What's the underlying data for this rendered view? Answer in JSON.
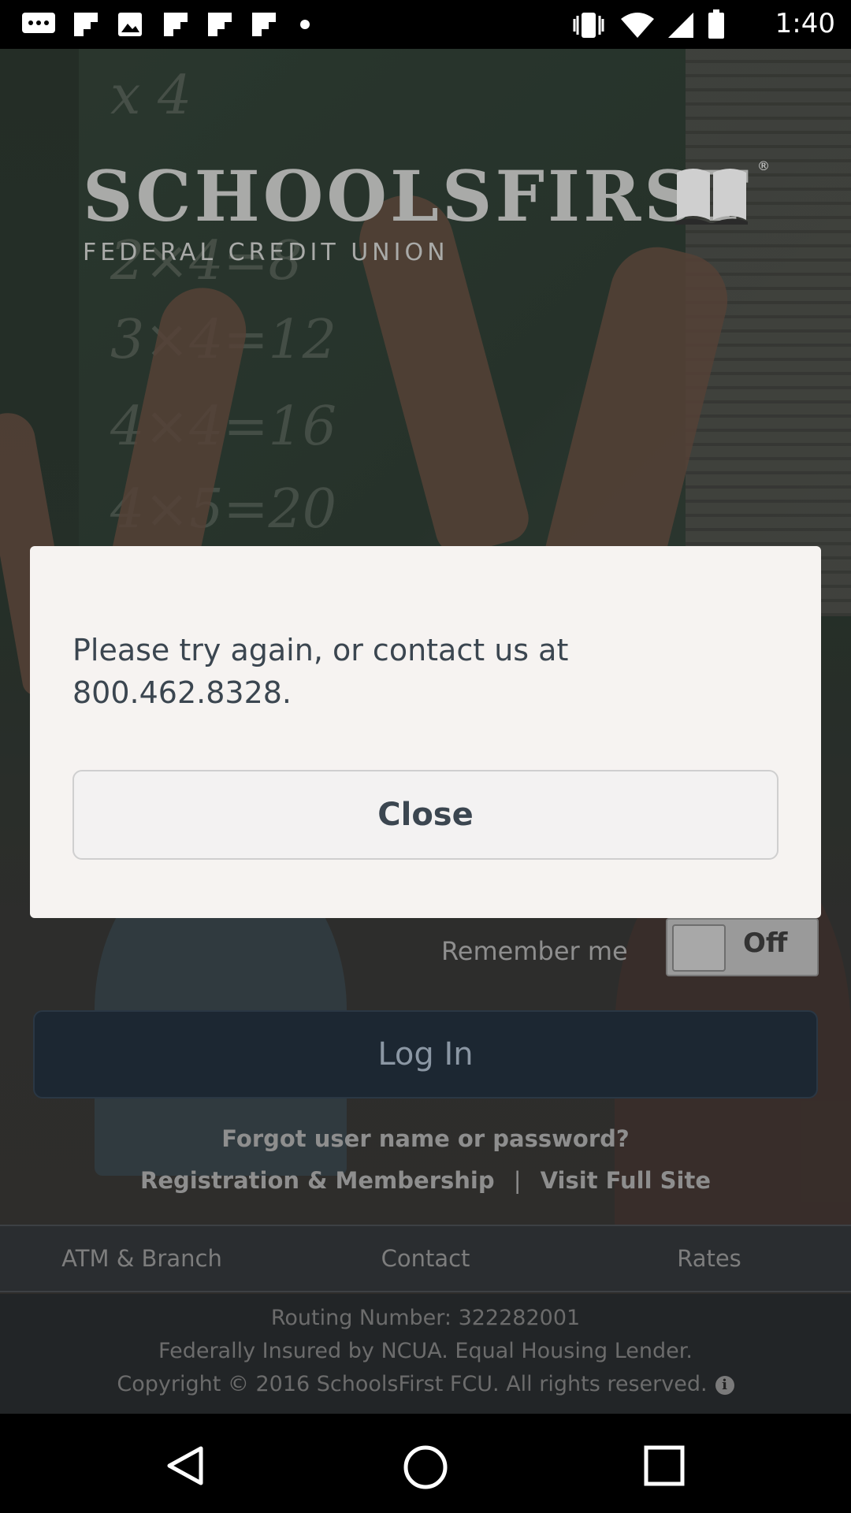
{
  "status_bar": {
    "time": "1:40",
    "icons": [
      "message-icon",
      "flipboard-icon",
      "photo-icon",
      "flipboard-icon",
      "flipboard-icon",
      "flipboard-icon",
      "dot-icon",
      "vibrate-icon",
      "wifi-icon",
      "signal-icon",
      "battery-icon"
    ]
  },
  "brand": {
    "title": "SCHOOLSFIRST",
    "registered": "®",
    "subtitle": "FEDERAL CREDIT UNION"
  },
  "chalk_lines": [
    "x 4",
    "2×4=8",
    "3×4=12",
    "4×4=16",
    "4×5=20"
  ],
  "modal": {
    "message": "Please try again, or contact us at 800.462.8328.",
    "close_label": "Close"
  },
  "login": {
    "remember_label": "Remember me",
    "remember_state": "Off",
    "login_label": "Log In",
    "forgot_label": "Forgot user name or password?",
    "registration_label": "Registration & Membership",
    "separator": "|",
    "full_site_label": "Visit Full Site"
  },
  "bottom_nav": {
    "items": [
      {
        "label": "ATM & Branch"
      },
      {
        "label": "Contact"
      },
      {
        "label": "Rates"
      }
    ]
  },
  "footer": {
    "routing": "Routing Number: 322282001",
    "insured": "Federally Insured by NCUA. Equal Housing Lender.",
    "copyright": "Copyright © 2016 SchoolsFirst FCU. All rights reserved.",
    "info_glyph": "i"
  },
  "colors": {
    "login_button": "#1c2732",
    "modal_bg": "#f6f3f1",
    "modal_text": "#3b4650"
  }
}
